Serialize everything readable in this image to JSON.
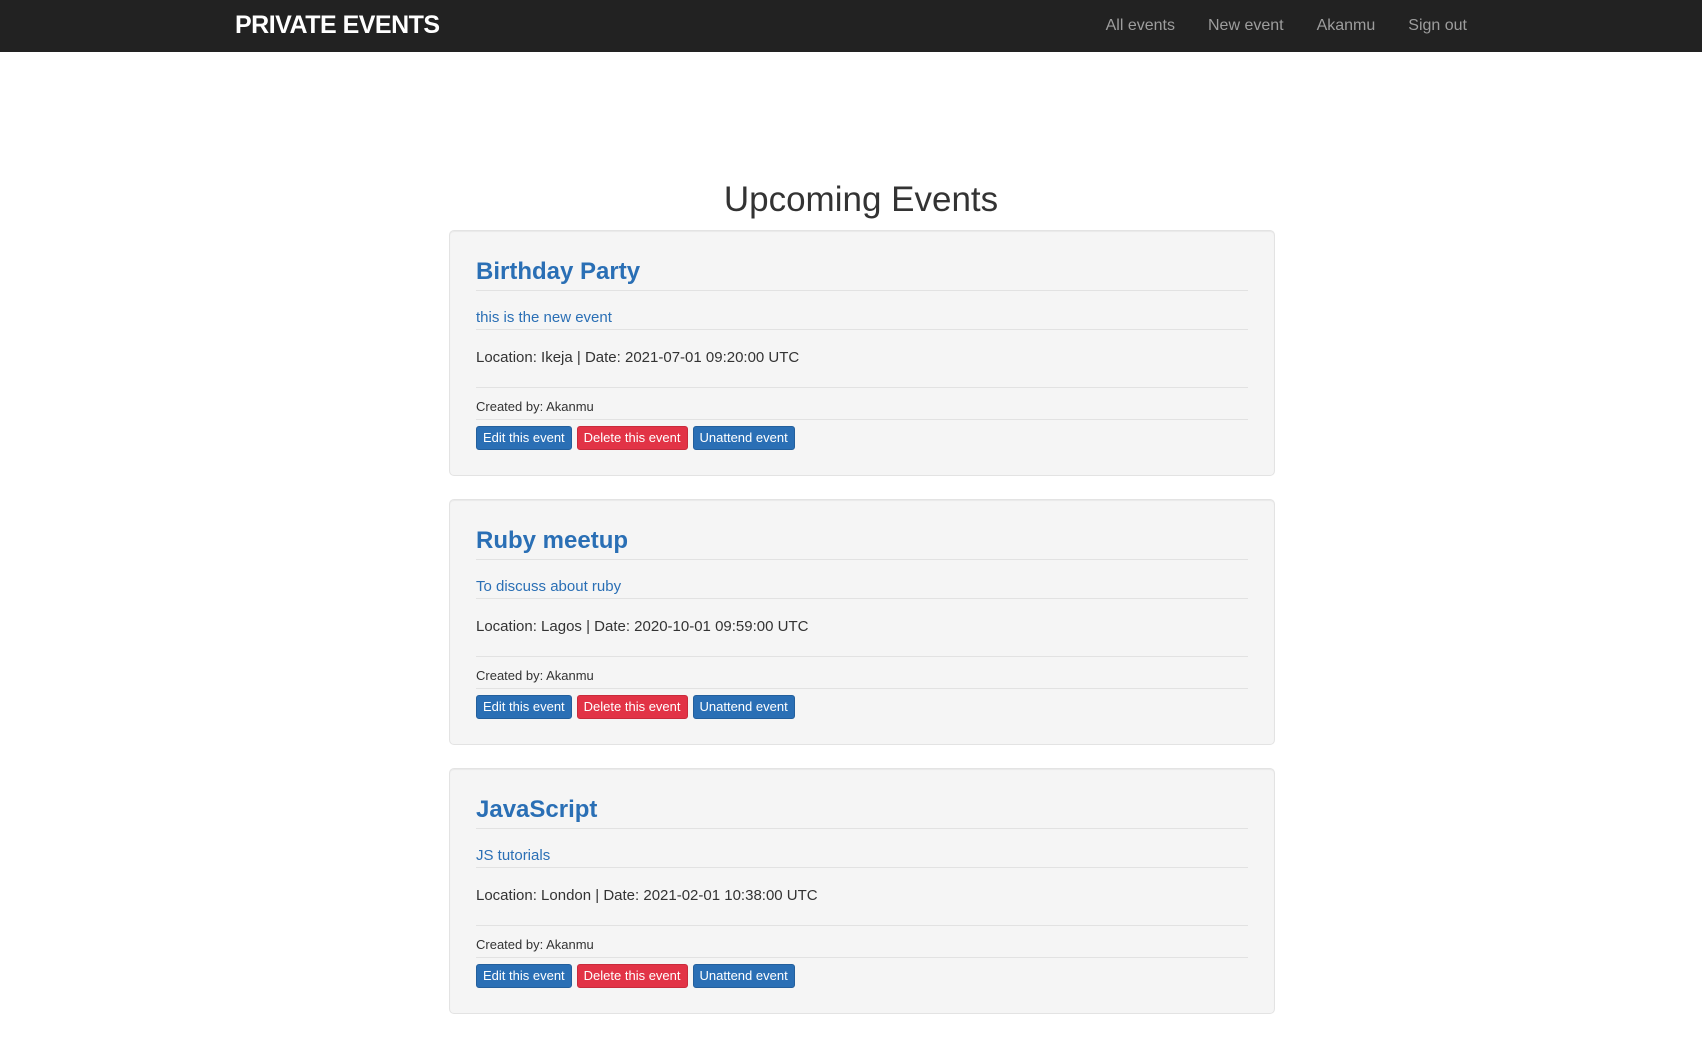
{
  "navbar": {
    "brand": "PRIVATE EVENTS",
    "links": [
      {
        "label": "All events"
      },
      {
        "label": "New event"
      },
      {
        "label": "Akanmu"
      },
      {
        "label": "Sign out"
      }
    ]
  },
  "main": {
    "title": "Upcoming Events",
    "events": [
      {
        "title": "Birthday Party",
        "description": "this is the new event",
        "meta": "Location: Ikeja | Date: 2021-07-01 09:20:00 UTC",
        "creator": "Created by: Akanmu",
        "edit_label": "Edit this event",
        "delete_label": "Delete this event",
        "unattend_label": "Unattend event"
      },
      {
        "title": "Ruby meetup",
        "description": "To discuss about ruby",
        "meta": "Location: Lagos | Date: 2020-10-01 09:59:00 UTC",
        "creator": "Created by: Akanmu",
        "edit_label": "Edit this event",
        "delete_label": "Delete this event",
        "unattend_label": "Unattend event"
      },
      {
        "title": "JavaScript",
        "description": "JS tutorials",
        "meta": "Location: London | Date: 2021-02-01 10:38:00 UTC",
        "creator": "Created by: Akanmu",
        "edit_label": "Edit this event",
        "delete_label": "Delete this event",
        "unattend_label": "Unattend event"
      }
    ]
  },
  "colors": {
    "navbar_bg": "#222222",
    "link_blue": "#2a6fb5",
    "danger_red": "#e23346",
    "card_bg": "#f5f5f5"
  }
}
